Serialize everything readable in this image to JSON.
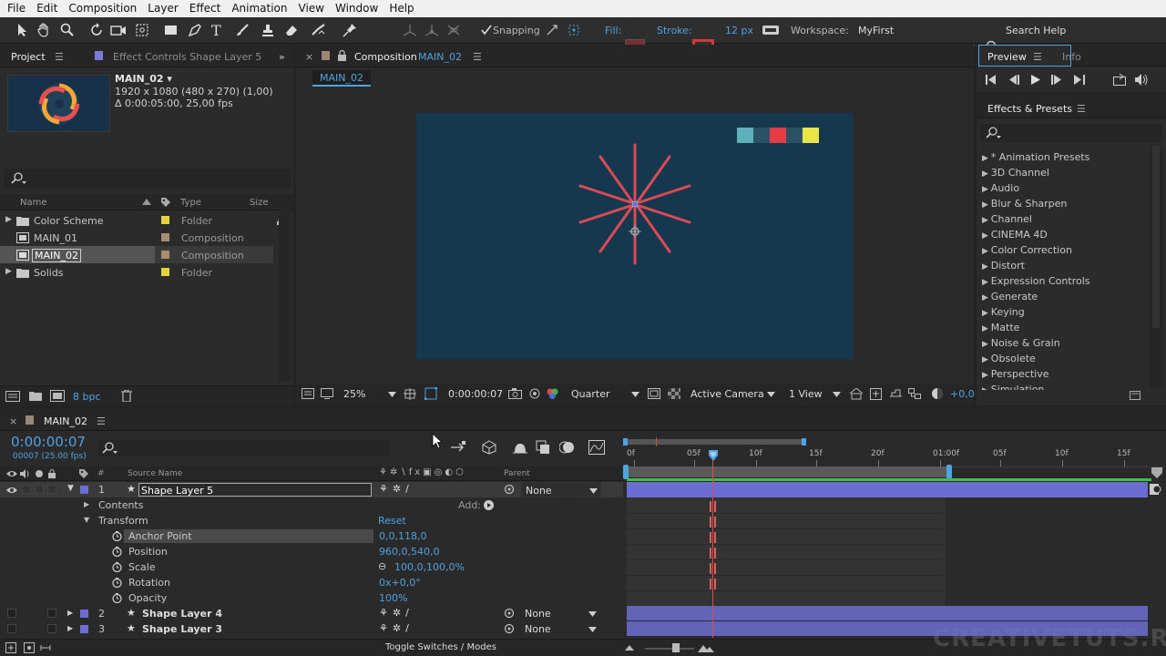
{
  "menu": [
    "File",
    "Edit",
    "Composition",
    "Layer",
    "Effect",
    "Animation",
    "View",
    "Window",
    "Help"
  ],
  "toolbar": {
    "snapping_label": "Snapping",
    "fill_label": "Fill:",
    "stroke_label": "Stroke:",
    "stroke_width": "12 px",
    "workspace_label": "Workspace:",
    "workspace_value": "MyFirst",
    "search_help": "Search Help",
    "fill_color": "#7a2d33",
    "stroke_color": "#d43a3a"
  },
  "project": {
    "tab_project": "Project",
    "tab_effect_controls": "Effect Controls Shape Layer 5",
    "comp_name": "MAIN_02 ▾",
    "comp_dims": "1920 x 1080  (480 x 270) (1,00)",
    "comp_duration": "Δ 0:00:05:00, 25,00 fps",
    "search_placeholder": "",
    "col_name": "Name",
    "col_type": "Type",
    "col_size": "Size",
    "items": [
      {
        "name": "Color Scheme",
        "type": "Folder",
        "color": "#e6d23e"
      },
      {
        "name": "MAIN_01",
        "type": "Composition",
        "color": "#a78c6f"
      },
      {
        "name": "MAIN_02",
        "type": "Composition",
        "color": "#a78c6f"
      },
      {
        "name": "Solids",
        "type": "Folder",
        "color": "#e6d23e"
      }
    ],
    "bpc": "8 bpc"
  },
  "composition": {
    "tab_label": "Composition",
    "tab_comp": "MAIN_02",
    "flow_label": "MAIN_02",
    "zoom": "25%",
    "timecode": "0:00:00:07",
    "resolution": "Quarter",
    "camera": "Active Camera",
    "views": "1 View",
    "exposure": "+0,0",
    "bg_color": "#15384f",
    "ray_color": "#dc4a55",
    "palette": [
      "#5fb0bd",
      "#2b5167",
      "#e63c44",
      "#2b5167",
      "#e8e544"
    ]
  },
  "preview": {
    "tab_preview": "Preview",
    "tab_info": "Info"
  },
  "effects": {
    "title": "Effects & Presets",
    "items": [
      "* Animation Presets",
      "3D Channel",
      "Audio",
      "Blur & Sharpen",
      "Channel",
      "CINEMA 4D",
      "Color Correction",
      "Distort",
      "Expression Controls",
      "Generate",
      "Keying",
      "Matte",
      "Noise & Grain",
      "Obsolete",
      "Perspective",
      "Simulation"
    ]
  },
  "timeline": {
    "tab_label": "MAIN_02",
    "timecode": "0:00:00:07",
    "frame_info": "00007 (25.00 fps)",
    "col_source": "Source Name",
    "col_parent": "Parent",
    "ruler": [
      "0f",
      "05f",
      "10f",
      "15f",
      "20f",
      "01:00f",
      "05f",
      "10f",
      "15f"
    ],
    "layers": [
      {
        "num": "1",
        "name": "Shape Layer 5",
        "parent": "None"
      },
      {
        "num": "2",
        "name": "Shape Layer 4",
        "parent": "None"
      },
      {
        "num": "3",
        "name": "Shape Layer 3",
        "parent": "None"
      }
    ],
    "contents_label": "Contents",
    "add_label": "Add:",
    "transform_label": "Transform",
    "reset_label": "Reset",
    "properties": [
      {
        "name": "Anchor Point",
        "value": "0,0,118,0"
      },
      {
        "name": "Position",
        "value": "960,0,540,0"
      },
      {
        "name": "Scale",
        "value": "100,0,100,0%"
      },
      {
        "name": "Rotation",
        "value": "0x+0,0°"
      },
      {
        "name": "Opacity",
        "value": "100%"
      }
    ],
    "toggle_label": "Toggle Switches / Modes",
    "watermark": "CREATIVETUTS.RU",
    "layer_color": "#6b6ed0"
  }
}
